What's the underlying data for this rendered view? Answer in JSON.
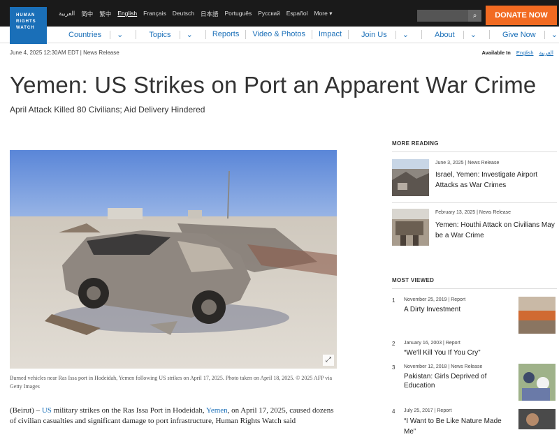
{
  "header": {
    "logo_lines": [
      "HUMAN",
      "RIGHTS",
      "WATCH"
    ],
    "languages": [
      "العربية",
      "简中",
      "繁中",
      "English",
      "Français",
      "Deutsch",
      "日本語",
      "Português",
      "Русский",
      "Español",
      "More"
    ],
    "active_language": "English",
    "search_placeholder": "",
    "donate_label": "DONATE NOW"
  },
  "nav": {
    "items": [
      "Countries",
      "Topics",
      "Reports",
      "Video & Photos",
      "Impact",
      "Join Us",
      "About",
      "Give Now"
    ]
  },
  "article": {
    "meta": "June 4, 2025 12:30AM EDT  |  News Release",
    "available_in_label": "Available In",
    "available_in": [
      "English",
      "العربية"
    ],
    "title": "Yemen: US Strikes on Port an Apparent War Crime",
    "subtitle": "April Attack Killed 80 Civilians; Aid Delivery Hindered",
    "caption": "Burned vehicles near Ras Issa port in Hodeidah, Yemen following US strikes on April 17, 2025. Photo taken on April 18, 2025. © 2025 AFP via Getty Images",
    "body_parts": [
      "(Beirut) – ",
      "US",
      " military strikes on the Ras Issa Port in Hodeidah, ",
      "Yemen",
      ", on April 17, 2025, caused dozens of civilian casualties and significant damage to port infrastructure, Human Rights Watch said"
    ]
  },
  "more_reading": {
    "heading": "MORE READING",
    "items": [
      {
        "date": "June 3, 2025",
        "type": "News Release",
        "title": "Israel, Yemen: Investigate Airport Attacks as War Crimes"
      },
      {
        "date": "February 13, 2025",
        "type": "News Release",
        "title": "Yemen: Houthi Attack on Civilians May be a War Crime"
      }
    ]
  },
  "most_viewed": {
    "heading": "MOST VIEWED",
    "items": [
      {
        "num": "1",
        "date": "November 25, 2019",
        "type": "Report",
        "title": "A Dirty Investment"
      },
      {
        "num": "2",
        "date": "January 16, 2003",
        "type": "Report",
        "title": "“We'll Kill You If You Cry”"
      },
      {
        "num": "3",
        "date": "November 12, 2018",
        "type": "News Release",
        "title": "Pakistan: Girls Deprived of Education"
      },
      {
        "num": "4",
        "date": "July 25, 2017",
        "type": "Report",
        "title": "“I Want to Be Like Nature Made Me”"
      }
    ]
  }
}
